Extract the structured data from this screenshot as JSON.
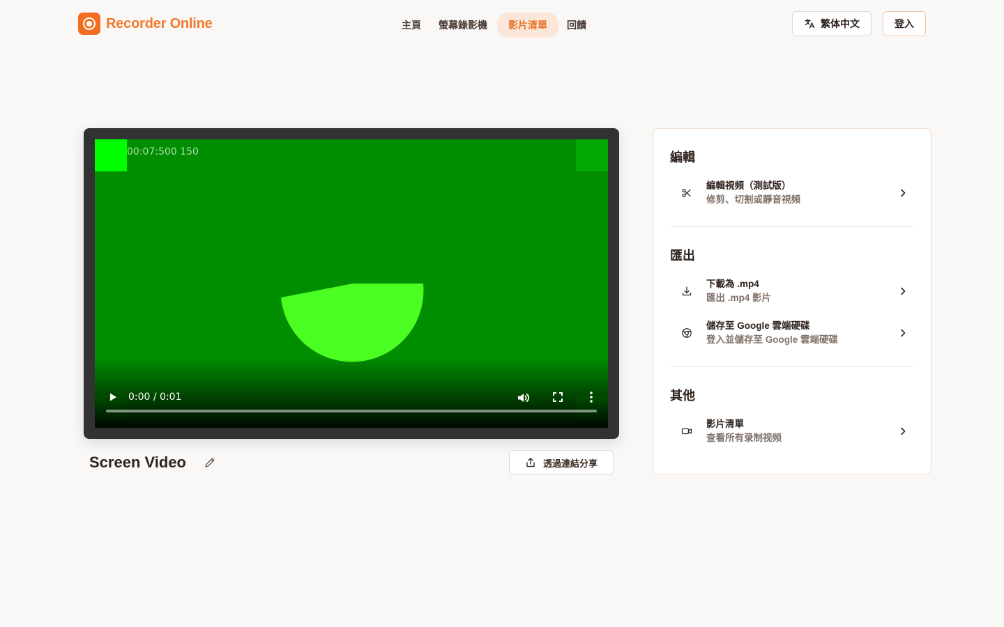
{
  "brand": {
    "name": "Recorder Online",
    "accent": "#f26d21"
  },
  "nav": {
    "items": [
      {
        "label": "主頁"
      },
      {
        "label": "螢幕錄影機"
      },
      {
        "label": "影片清單",
        "active": true
      },
      {
        "label": "回饋"
      }
    ]
  },
  "header": {
    "language_label": "繁体中文",
    "login_label": "登入"
  },
  "player": {
    "overlay_text": "00:07:500 150",
    "time_display": "0:00 / 0:01",
    "progress": 0.0,
    "background_color": "#008d00"
  },
  "video": {
    "title": "Screen Video",
    "share_label": "透過連結分享"
  },
  "panel": {
    "sections": [
      {
        "title": "編輯",
        "items": [
          {
            "title": "編輯視頻（測試版）",
            "subtitle": "修剪、切割或靜音視頻",
            "icon": "scissors-icon"
          }
        ]
      },
      {
        "title": "匯出",
        "items": [
          {
            "title": "下載為 .mp4",
            "subtitle": "匯出 .mp4 影片",
            "icon": "download-icon"
          },
          {
            "title": "儲存至 Google 雲端硬碟",
            "subtitle": "登入並儲存至 Google 雲端硬碟",
            "icon": "google-icon"
          }
        ]
      },
      {
        "title": "其他",
        "items": [
          {
            "title": "影片清單",
            "subtitle": "查看所有录制视频",
            "icon": "video-camera-icon"
          }
        ]
      }
    ]
  }
}
